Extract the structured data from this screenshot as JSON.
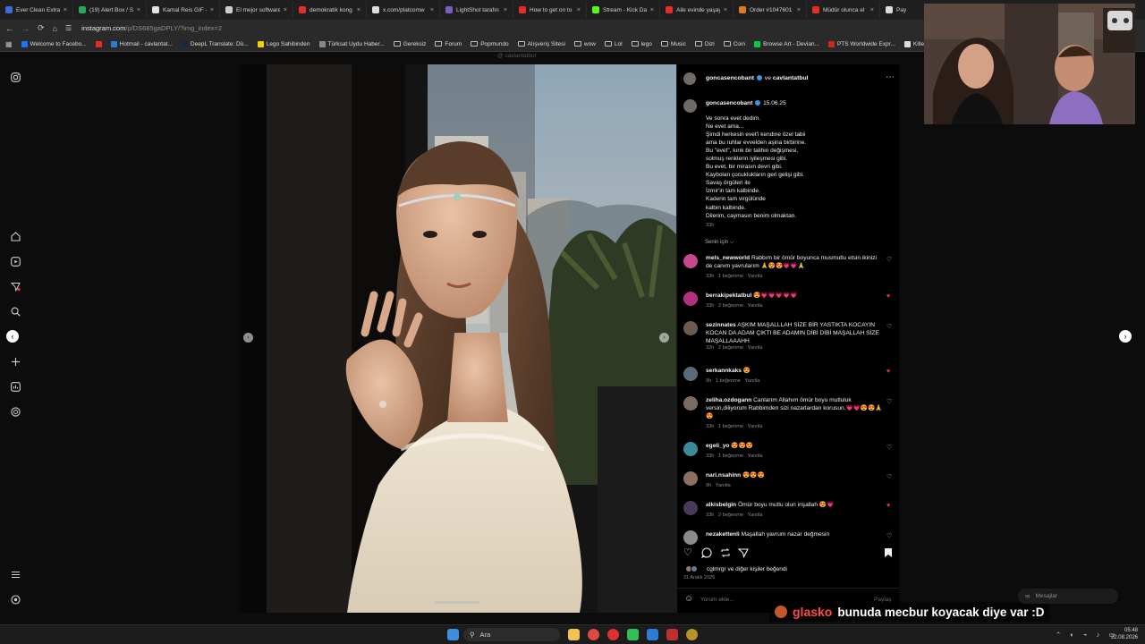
{
  "browser": {
    "tabs": [
      {
        "title": "Ever Clean Extra",
        "color": "#3a6ed8"
      },
      {
        "title": "(19) Alert Box / St",
        "color": "#2fa55c"
      },
      {
        "title": "Kamal Reis GIF - F",
        "color": "#e0e0e0"
      },
      {
        "title": "El mejor software",
        "color": "#cccccc"
      },
      {
        "title": "demokratik kong",
        "color": "#e52d27"
      },
      {
        "title": "x.com/platcomw",
        "color": "#dddddd"
      },
      {
        "title": "LightShot tarafın",
        "color": "#7a5fc0"
      },
      {
        "title": "How to get on to",
        "color": "#e52d27"
      },
      {
        "title": "Stream - Kick Da",
        "color": "#53fc18"
      },
      {
        "title": "Aile evinde yaşay",
        "color": "#e52d27"
      },
      {
        "title": "Order #1047601",
        "color": "#e07a20"
      },
      {
        "title": "Müdür olunca el",
        "color": "#e52d27"
      },
      {
        "title": "Pay",
        "color": "#dddddd"
      }
    ],
    "url_host": "instagram.com",
    "url_path": "/p/DS685gaDPLY/?img_index=2",
    "bookmarks": [
      {
        "label": "Welcome to Facebo...",
        "color": "#1877f2"
      },
      {
        "label": "",
        "color": "#e52d27"
      },
      {
        "label": "Hotmail - cavlantat...",
        "color": "#2b7cd3"
      },
      {
        "label": "DeepL Translate: Dü...",
        "color": "#0f2b46"
      },
      {
        "label": "Lego Sahibinden",
        "color": "#f5d000"
      },
      {
        "label": "Türksat Uydu Haber...",
        "color": "#888888"
      },
      {
        "label": "Gereksiz",
        "color": "folder"
      },
      {
        "label": "Forum",
        "color": "folder"
      },
      {
        "label": "Popmundo",
        "color": "folder"
      },
      {
        "label": "Alışveriş Sitesi",
        "color": "folder"
      },
      {
        "label": "wow",
        "color": "folder"
      },
      {
        "label": "Lol",
        "color": "folder"
      },
      {
        "label": "lego",
        "color": "folder"
      },
      {
        "label": "Music",
        "color": "folder"
      },
      {
        "label": "Dizi",
        "color": "folder"
      },
      {
        "label": "Coin",
        "color": "folder"
      },
      {
        "label": "Browse Art - Devian...",
        "color": "#05cc47"
      },
      {
        "label": "PTS Worldwide Expr...",
        "color": "#c62828"
      },
      {
        "label": "Killer Home Chest...",
        "color": "#dddddd"
      }
    ]
  },
  "post": {
    "watermark": "@ cavlantatbul",
    "header": {
      "user": "goncasencobant",
      "connector": "ve",
      "coauthor": "cavlantatbul"
    },
    "caption": {
      "user": "goncasencobant",
      "date": "15.06.25",
      "lines": [
        "Ve sonra evet dedim.",
        "Ne evet ama...",
        "Şimdi herkesin evet'i kendine özel tabii",
        "ama bu ruhlar evvelden aşina birbirine.",
        "Bu \"evet\", kırık bir talihin değişmesi,",
        "solmuş renklerin iyileşmesi gibi.",
        "Bu evet, bir mirasın devri gibi.",
        "Kaybolan çocuklukların geri gelişi gibi.",
        "Savaş örgüleri ile",
        "İzmir'in tam kalbinde.",
        "Kaderin tam virgülünde",
        "kalbin kalbinde.",
        "Dilerim, caymasın benim olmaktan."
      ],
      "age": "33h"
    },
    "sort_label": "Senin için",
    "comments": [
      {
        "user": "mels_newworld",
        "text": "Rabbım bir ömür boyunca musmutlu etsin ikinizi de canım yavrularım 🙏😍😍💗💗🙏",
        "meta": "33h   1 beğenme   Yanıtla",
        "liked": false,
        "avatar": "#c64a8a"
      },
      {
        "user": "berrakipektatbul",
        "text": "😍💗💗💗💗💗",
        "meta": "33h   2 beğenme   Yanıtla",
        "liked": true,
        "avatar": "#b23080"
      },
      {
        "user": "sezinnates",
        "text": "AŞKIM MAŞALLLAH SİZE BİR YASTIKTA KOCAYIN KOCAN DA ADAM ÇIKTI BE ADAMIN DİBİ DİBİ MAŞALLAH SİZE MAŞALLAAAHH",
        "meta": "32h   2 beğenme   Yanıtla",
        "liked": false,
        "avatar": "#6a5a50"
      },
      {
        "user": "serkannkaks",
        "text": "😍",
        "meta": "9h   1 beğenme   Yanıtla",
        "liked": true,
        "avatar": "#5a6a78"
      },
      {
        "user": "zeliha.ozdogann",
        "text": "Canlarım Allahım ömür boyu mutluluk versin,diliyorum Rabbimden sizi nazarlardan korusun.💗💗😍😍🙏😍",
        "meta": "33h   1 beğenme   Yanıtla",
        "liked": false,
        "avatar": "#7a6a60"
      },
      {
        "user": "egeli_yo",
        "text": "😍😍😍",
        "meta": "33h   1 beğenme   Yanıtla",
        "liked": false,
        "avatar": "#3a8a9a"
      },
      {
        "user": "nari.nsahinn",
        "text": "😍😍😍",
        "meta": "9h   Yanıtla",
        "liked": false,
        "avatar": "#8a7060"
      },
      {
        "user": "alkisbelgin",
        "text": "Ömür boyu mutlu olun inşallah 😍💗",
        "meta": "33h   2 beğenme   Yanıtla",
        "liked": true,
        "avatar": "#4a3a5a"
      },
      {
        "user": "nezakettenli",
        "text": "Maşallah yavrum nazar değmesin",
        "meta": "",
        "liked": false,
        "avatar": "#8a8a8a"
      }
    ],
    "likes_text": "cglmrgr ve diğer kişiler beğendi",
    "post_date": "31 Aralık 2025",
    "comment_placeholder": "Yorum ekle...",
    "share_label": "Paylaş"
  },
  "overlay": {
    "chat_user": "glasko",
    "chat_message": "bunuda mecbur koyacak diye var :D",
    "messages_label": "Mesajlar"
  },
  "taskbar": {
    "search_label": "Ara",
    "time": "05:48",
    "date": "22.08.2026"
  }
}
